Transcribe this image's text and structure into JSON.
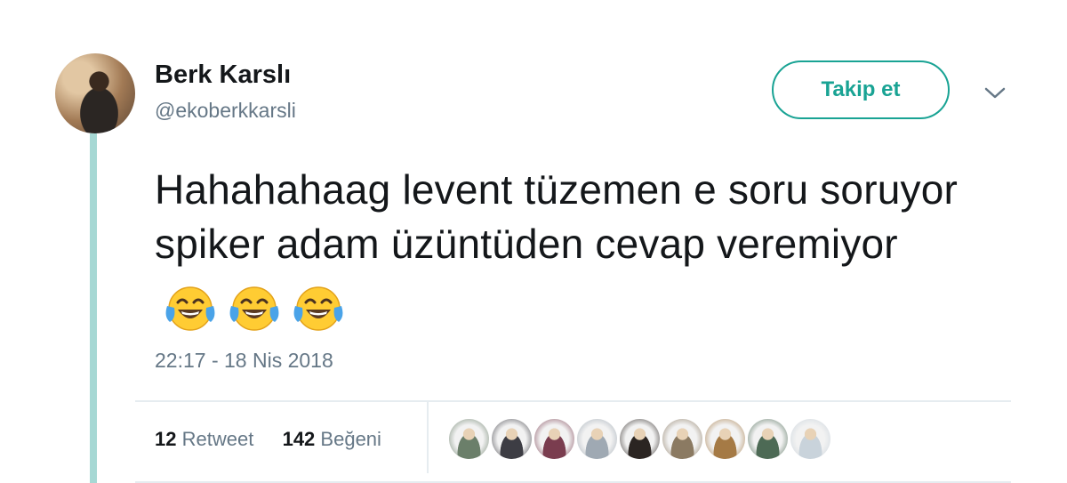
{
  "user": {
    "display_name": "Berk Karslı",
    "handle": "@ekoberkkarsli"
  },
  "actions": {
    "follow_label": "Takip et",
    "more_icon": "chevron-down-icon"
  },
  "tweet": {
    "text": "Hahahahaag levent tüzemen e soru soruyor spiker adam üzüntüden cevap veremiyor",
    "emojis": [
      "face-with-tears-of-joy",
      "face-with-tears-of-joy",
      "face-with-tears-of-joy"
    ],
    "timestamp": "22:17 - 18 Nis 2018"
  },
  "stats": {
    "retweet_count": "12",
    "retweet_label": "Retweet",
    "like_count": "142",
    "like_label": "Beğeni"
  },
  "colors": {
    "accent": "#19a394",
    "thread_line": "#a6d8d4",
    "secondary_text": "#657786",
    "primary_text": "#14171a",
    "divider": "#e6ecf0"
  },
  "likers": [
    {
      "name": "liker-avatar-1",
      "bg": "#6b7f6a"
    },
    {
      "name": "liker-avatar-2",
      "bg": "#3d3d44"
    },
    {
      "name": "liker-avatar-3",
      "bg": "#7a3d4f"
    },
    {
      "name": "liker-avatar-4",
      "bg": "#9fa9b3"
    },
    {
      "name": "liker-avatar-5",
      "bg": "#2b2522"
    },
    {
      "name": "liker-avatar-6",
      "bg": "#8b7a62"
    },
    {
      "name": "liker-avatar-7",
      "bg": "#a57a45"
    },
    {
      "name": "liker-avatar-8",
      "bg": "#4d6a55"
    },
    {
      "name": "liker-avatar-9",
      "bg": "#c9d3db"
    }
  ]
}
